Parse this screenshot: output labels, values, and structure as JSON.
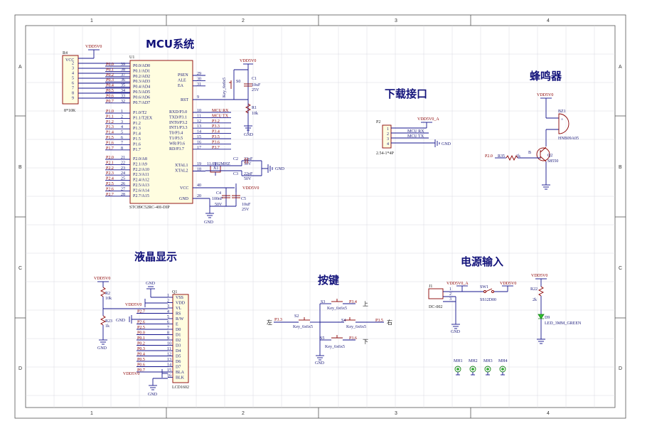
{
  "sections": {
    "mcu": "MCU系统",
    "download": "下载接口",
    "buzzer": "蜂鸣器",
    "lcd": "液晶显示",
    "keys": "按键",
    "power": "电源输入"
  },
  "border": {
    "cols": [
      "1",
      "2",
      "3",
      "4"
    ],
    "rows": [
      "A",
      "B",
      "C",
      "D"
    ]
  },
  "mcu": {
    "ref": "U1",
    "part": "STC89C52RC-40I-DIP",
    "power_net": "VDD5V0",
    "r4_ref": "R4",
    "r4_val": "8*10K",
    "r4_vcc": "VCC",
    "r4_pins": [
      "2",
      "3",
      "4",
      "5",
      "6",
      "7",
      "8",
      "9"
    ],
    "p0_nets": [
      "P0.0",
      "P0.1",
      "P0.2",
      "P0.3",
      "P0.4",
      "P0.5",
      "P0.6",
      "P0.7"
    ],
    "p0_pins": [
      "39",
      "38",
      "37",
      "36",
      "35",
      "34",
      "33",
      "32"
    ],
    "p0_names": [
      "P0.0/AD0",
      "P0.1/AD1",
      "P0.2/AD2",
      "P0.3/AD3",
      "P0.4/AD4",
      "P0.5/AD5",
      "P0.6/AD6",
      "P0.7/AD7"
    ],
    "p1_nets": [
      "P1.0",
      "P1.1",
      "P1.2",
      "P1.3",
      "P1.4",
      "P1.5",
      "P1.6",
      "P1.7"
    ],
    "p1_pins": [
      "1",
      "2",
      "3",
      "4",
      "5",
      "6",
      "7",
      "8"
    ],
    "p1_names": [
      "P1.0/T2",
      "P1.1/T2EX",
      "P1.2",
      "P1.3",
      "P1.4",
      "P1.5",
      "P1.6",
      "P1.7"
    ],
    "p2_nets": [
      "P2.0",
      "P2.1",
      "P2.2",
      "P2.3",
      "P2.4",
      "P2.5",
      "P2.6",
      "P2.7"
    ],
    "p2_pins": [
      "21",
      "22",
      "23",
      "24",
      "25",
      "26",
      "27",
      "28"
    ],
    "p2_names": [
      "P2.0/A8",
      "P2.1/A9",
      "P2.2/A10",
      "P2.3/A11",
      "P2.4/A12",
      "P2.5/A13",
      "P2.6/A14",
      "P2.7/A15"
    ],
    "right_top_names": [
      "PSEN",
      "ALE",
      "EA"
    ],
    "right_top_pins": [
      "29",
      "30",
      "31"
    ],
    "rst_name": "RST",
    "rst_pin": "9",
    "p3_names": [
      "RXD/P3.0",
      "TXD/P3.1",
      "INT0/P3.2",
      "INT1/P3.3",
      "T0/P3.4",
      "T1/P3.5",
      "WR/P3.6",
      "RD/P3.7"
    ],
    "p3_pins": [
      "10",
      "11",
      "12",
      "13",
      "14",
      "15",
      "16",
      "17"
    ],
    "p3_nets": [
      "MCU RX",
      "MCU TX",
      "P3.2",
      "P3.3",
      "P3.4",
      "P3.5",
      "P3.6",
      "P3.7"
    ],
    "xtal_names": [
      "XTAL1",
      "XTAL2"
    ],
    "xtal_pins": [
      "19",
      "18"
    ],
    "vcc_name": "VCC",
    "vcc_pin": "40",
    "gnd_name": "GND",
    "gnd_pin": "20"
  },
  "reset": {
    "switch_ref": "S0",
    "switch_val": "Key_6x6x5",
    "cap_ref": "C1",
    "cap_val": "10uF",
    "cap_volt": "25V",
    "res_ref": "R1",
    "res_val": "10k",
    "power_net": "VDD5V0",
    "gnd": "GND"
  },
  "crystal": {
    "ref": "X1",
    "val": "11.0592MHZ",
    "c2_ref": "C2",
    "c2_val": "22pF",
    "c2_volt": "50V",
    "c3_ref": "C3",
    "c3_val": "22pF",
    "c3_volt": "50V",
    "gnd": "GND"
  },
  "decoupling": {
    "c4_ref": "C4",
    "c4_val": "100nF",
    "c4_volt": "50V",
    "c5_ref": "C5",
    "c5_val": "10uF",
    "c5_volt": "25V",
    "power_net": "VDD5V0",
    "gnd": "GND"
  },
  "download": {
    "ref": "P2",
    "part": "2.54-1*4P",
    "pins": [
      "1",
      "2",
      "3",
      "4"
    ],
    "power_net": "VDD5V0_A",
    "nets": [
      "MCU RX",
      "MCU TX"
    ],
    "gnd": "GND"
  },
  "buzzer": {
    "ref": "BZ1",
    "part": "HNB09A05",
    "power_net": "VDD5V0",
    "q_ref": "Q2",
    "q_part": "S8550",
    "r_ref": "R35",
    "r_val": "1k",
    "net": "P2.0",
    "pin_b": "B",
    "plus": "+"
  },
  "lcd": {
    "ref": "Q1",
    "part": "LCD1602",
    "pins": [
      "1",
      "2",
      "3",
      "4",
      "5",
      "6",
      "7",
      "8",
      "9",
      "10",
      "11",
      "12",
      "13",
      "14",
      "15",
      "16"
    ],
    "pin_names": [
      "VSS",
      "VDD",
      "VL",
      "RS",
      "R/W",
      "E",
      "D0",
      "D1",
      "D2",
      "D3",
      "D4",
      "D5",
      "D6",
      "D7",
      "BLA",
      "BLK"
    ],
    "nets": [
      "P2.7",
      "P2.6",
      "P2.5",
      "P0.0",
      "P0.1",
      "P0.2",
      "P0.3",
      "P0.4",
      "P0.5",
      "P0.6",
      "P0.7"
    ],
    "power_net": "VDD5V0",
    "gnd": "GND",
    "r2_ref": "R2",
    "r2_val": "10k",
    "r23_ref": "R23",
    "r23_val": "1k"
  },
  "keys": {
    "items": [
      {
        "ref": "S3",
        "val": "Key_6x6x5",
        "net": "P3.4",
        "dir": "上"
      },
      {
        "ref": "S2",
        "val": "Key_6x6x5",
        "net": "P3.3",
        "dir": "左"
      },
      {
        "ref": "S4",
        "val": "Key_6x6x5",
        "net": "P3.5",
        "dir": "右"
      },
      {
        "ref": "S5",
        "val": "Key_6x6x5",
        "net": "P3.6",
        "dir": "下"
      }
    ],
    "gnd": "GND"
  },
  "power": {
    "jack_ref": "J1",
    "jack_part": "DC-002",
    "jack_pins": [
      "1",
      "2",
      "3"
    ],
    "net_a": "VDD5V0_A",
    "sw_ref": "SW1",
    "sw_part": "SS12D00",
    "net_out": "VDD5V0",
    "gnd": "GND",
    "led_net": "VDD5V0",
    "r22_ref": "R22",
    "r22_val": "2k",
    "led_ref": "D9",
    "led_part": "LED_3MM_GREEN",
    "holes": [
      "MH1",
      "MH2",
      "MH3",
      "MH4"
    ]
  },
  "colors": {
    "wire": "#14148c",
    "component": "#8b0000",
    "chip_fill": "#fffde0",
    "title": "#12127a"
  }
}
